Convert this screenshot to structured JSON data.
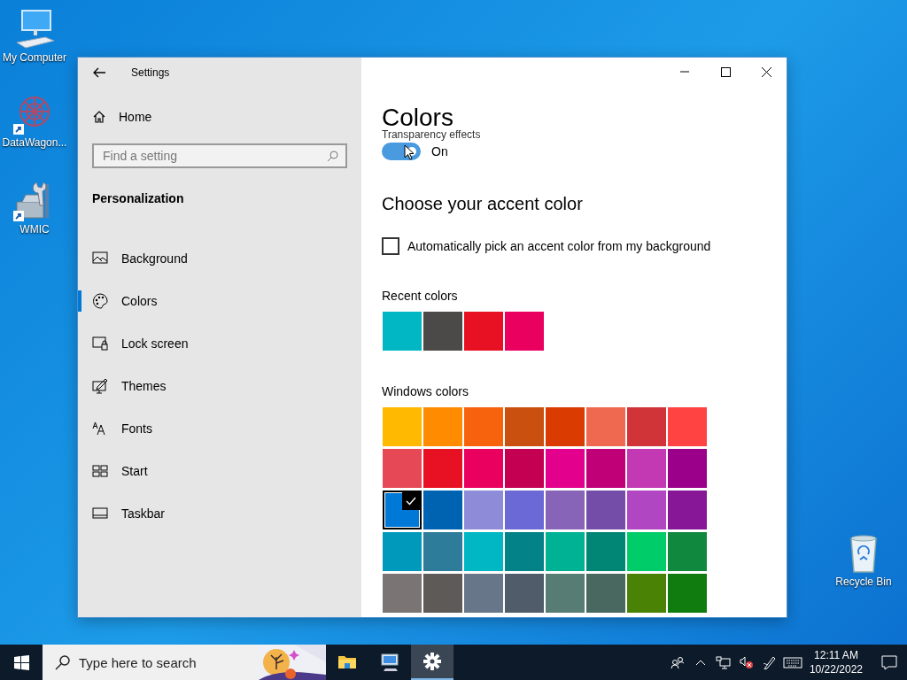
{
  "desktop_icons": [
    {
      "label": "My Computer",
      "kind": "computer"
    },
    {
      "label": "DataWagon...",
      "kind": "network",
      "shortcut": true
    },
    {
      "label": "WMIC",
      "kind": "toolbox",
      "shortcut": true
    },
    {
      "label": "Recycle Bin",
      "kind": "bin"
    }
  ],
  "window": {
    "title": "Settings"
  },
  "sidebar": {
    "home": "Home",
    "search": {
      "placeholder": "Find a setting"
    },
    "section": "Personalization",
    "items": [
      {
        "label": "Background",
        "kind": "background",
        "selected": false
      },
      {
        "label": "Colors",
        "kind": "colors",
        "selected": true
      },
      {
        "label": "Lock screen",
        "kind": "lock",
        "selected": false
      },
      {
        "label": "Themes",
        "kind": "themes",
        "selected": false
      },
      {
        "label": "Fonts",
        "kind": "fonts",
        "selected": false
      },
      {
        "label": "Start",
        "kind": "start",
        "selected": false
      },
      {
        "label": "Taskbar",
        "kind": "taskbar",
        "selected": false
      }
    ]
  },
  "content": {
    "title": "Colors",
    "transparency": {
      "label": "Transparency effects",
      "on": true,
      "state_text": "On"
    },
    "accent_heading": "Choose your accent color",
    "auto_pick": {
      "label": "Automatically pick an accent color from my background",
      "checked": false
    },
    "recent_label": "Recent colors",
    "recent_colors": [
      {
        "color": "#00b7c3"
      },
      {
        "color": "#4c4a48"
      },
      {
        "color": "#e81123"
      },
      {
        "color": "#ea005e"
      }
    ],
    "windows_label": "Windows colors",
    "windows_colors": [
      {
        "color": "#ffb900",
        "selected": false
      },
      {
        "color": "#ff8c00",
        "selected": false
      },
      {
        "color": "#f7630c",
        "selected": false
      },
      {
        "color": "#ca5010",
        "selected": false
      },
      {
        "color": "#da3b01",
        "selected": false
      },
      {
        "color": "#ef6950",
        "selected": false
      },
      {
        "color": "#d13438",
        "selected": false
      },
      {
        "color": "#ff4343",
        "selected": false
      },
      {
        "color": "#e74856",
        "selected": false
      },
      {
        "color": "#e81123",
        "selected": false
      },
      {
        "color": "#ea005e",
        "selected": false
      },
      {
        "color": "#c30052",
        "selected": false
      },
      {
        "color": "#e3008c",
        "selected": false
      },
      {
        "color": "#bf0077",
        "selected": false
      },
      {
        "color": "#c239b3",
        "selected": false
      },
      {
        "color": "#9a0089",
        "selected": false
      },
      {
        "color": "#0078d7",
        "selected": true
      },
      {
        "color": "#0063b1",
        "selected": false
      },
      {
        "color": "#8e8cd8",
        "selected": false
      },
      {
        "color": "#6b69d6",
        "selected": false
      },
      {
        "color": "#8764b8",
        "selected": false
      },
      {
        "color": "#744da9",
        "selected": false
      },
      {
        "color": "#b146c2",
        "selected": false
      },
      {
        "color": "#881798",
        "selected": false
      },
      {
        "color": "#0099bc",
        "selected": false
      },
      {
        "color": "#2d7d9a",
        "selected": false
      },
      {
        "color": "#00b7c3",
        "selected": false
      },
      {
        "color": "#038387",
        "selected": false
      },
      {
        "color": "#00b294",
        "selected": false
      },
      {
        "color": "#018574",
        "selected": false
      },
      {
        "color": "#00cc6a",
        "selected": false
      },
      {
        "color": "#10893e",
        "selected": false
      },
      {
        "color": "#7a7574",
        "selected": false
      },
      {
        "color": "#5d5a58",
        "selected": false
      },
      {
        "color": "#68768a",
        "selected": false
      },
      {
        "color": "#515c6b",
        "selected": false
      },
      {
        "color": "#567c73",
        "selected": false
      },
      {
        "color": "#486860",
        "selected": false
      },
      {
        "color": "#498205",
        "selected": false
      },
      {
        "color": "#107c10",
        "selected": false
      }
    ]
  },
  "taskbar": {
    "search": {
      "placeholder": "Type here to search"
    },
    "apps": [
      {
        "kind": "folder",
        "selected": false
      },
      {
        "kind": "computer",
        "selected": false
      },
      {
        "kind": "settings",
        "selected": true
      }
    ],
    "tray": [
      {
        "kind": "people"
      },
      {
        "kind": "chevron"
      },
      {
        "kind": "network"
      },
      {
        "kind": "volume-muted"
      },
      {
        "kind": "pen"
      },
      {
        "kind": "keyboard"
      }
    ],
    "time": "12:11 AM",
    "date": "10/22/2022"
  }
}
